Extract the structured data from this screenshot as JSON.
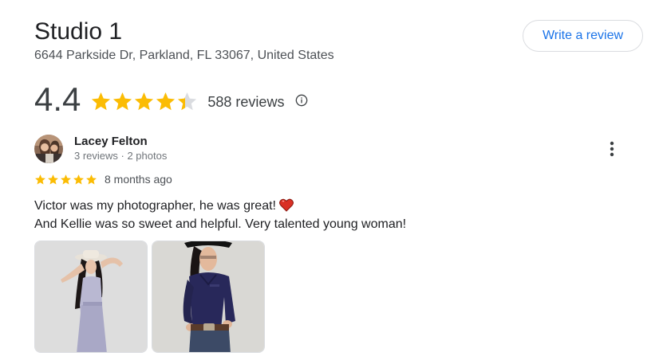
{
  "place": {
    "title": "Studio 1",
    "address": "6644 Parkside Dr, Parkland, FL 33067, United States"
  },
  "actions": {
    "write_review_label": "Write a review"
  },
  "rating": {
    "value": "4.4",
    "stars_filled": 4.4,
    "stars_total": 5,
    "count_label": "588 reviews",
    "star_color": "#fbbc04",
    "star_empty_color": "#dadce0"
  },
  "review": {
    "reviewer_name": "Lacey Felton",
    "reviewer_meta": "3 reviews · 2 photos",
    "stars": 5,
    "date": "8 months ago",
    "text_line1": "Victor was my photographer, he was great!",
    "text_line2": "And Kellie was so sweet and helpful. Very talented young woman!",
    "emoji": "heart-icon",
    "photo_count": 2
  },
  "icons": {
    "info": "info-icon",
    "more": "more-vert-icon"
  },
  "colors": {
    "link": "#1a73e8",
    "heart": "#d93025"
  }
}
